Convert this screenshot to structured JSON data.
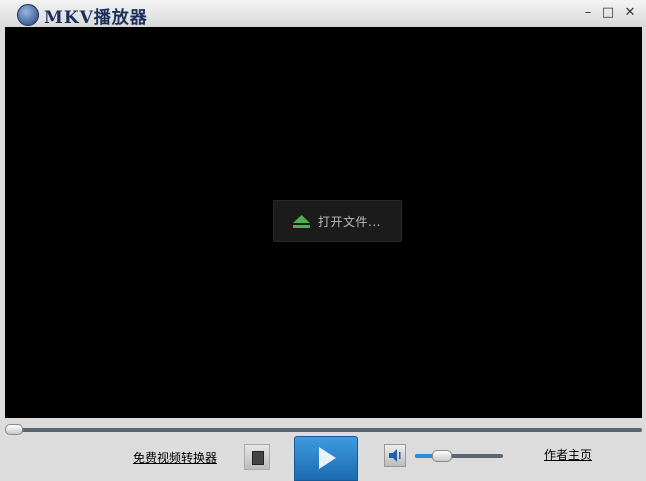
{
  "window": {
    "title": "MKV播放器",
    "minimize": "–",
    "maximize": "□",
    "close": "✕"
  },
  "video": {
    "open_file_label": "打开文件..."
  },
  "controls": {
    "converter_link": "免费视频转换器",
    "author_link": "作者主页",
    "seek_progress": 0,
    "volume_level": 0.3
  },
  "colors": {
    "accent": "#2a8ad8",
    "eject": "#4caf50"
  }
}
